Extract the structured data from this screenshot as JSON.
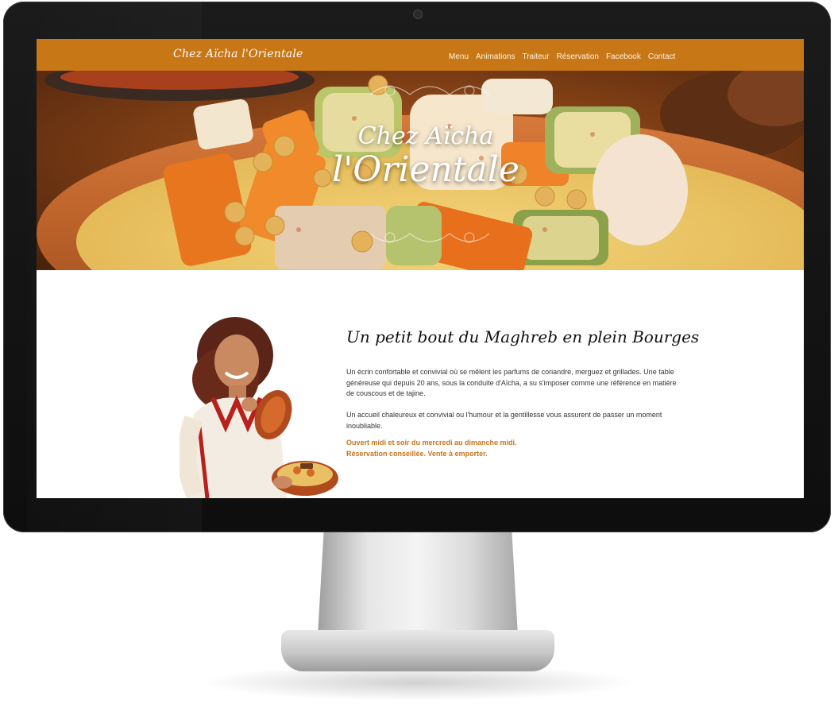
{
  "site": {
    "logo": "Chez Aïcha l'Orientale",
    "nav": [
      "Menu",
      "Animations",
      "Traiteur",
      "Réservation",
      "Facebook",
      "Contact"
    ]
  },
  "hero": {
    "title_line1": "Chez Aïcha",
    "title_line2": "l'Orientale"
  },
  "intro": {
    "heading": "Un petit bout du Maghreb en plein Bourges",
    "paragraph1": "Un écrin confortable et convivial où se mêlent les parfums de coriandre, merguez et grillades. Une table généreuse qui depuis 20 ans, sous la conduite d'Aïcha, a su s'imposer comme une référence en matière de couscous et de tajine.",
    "paragraph2": "Un accueil chaleureux et convivial ou l'humour et la gentillesse vous assurent de passer un moment inoubliable.",
    "hours_line1": "Ouvert midi et soir du mercredi au dimanche midi.",
    "hours_line2": "Réservation conseillée. Vente à emporter."
  },
  "colors": {
    "nav_bg": "#c87717",
    "accent_text": "#c8741b",
    "monitor_bezel": "#111111"
  }
}
